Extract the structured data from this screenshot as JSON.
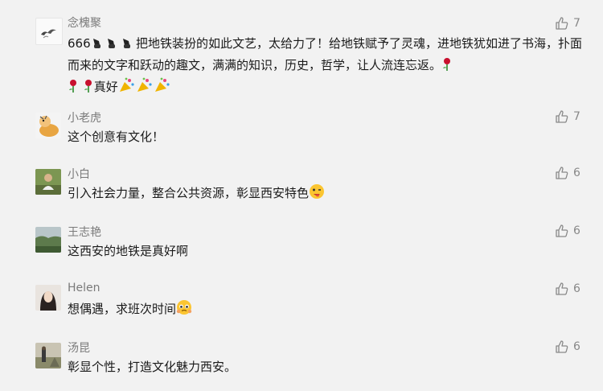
{
  "comments": [
    {
      "name": "念槐聚",
      "text_part1": "666",
      "text_part2": " 把地铁装扮的如此文艺，太给力了！给地铁赋予了灵魂，进地铁犹如进了书海，扑面而来的文字和跃动的趣文，满满的知识，历史，哲学，让人流连忘返。",
      "text_part3": "真好",
      "likes": "7",
      "avatar_icon": "swallows-avatar-icon"
    },
    {
      "name": "小老虎",
      "text": "这个创意有文化！",
      "likes": "7",
      "avatar_icon": "cartoon-avatar-icon"
    },
    {
      "name": "小白",
      "text": "引入社会力量，整合公共资源，彰显西安特色",
      "likes": "6",
      "avatar_icon": "person-photo-avatar-icon"
    },
    {
      "name": "王志艳",
      "text": "这西安的地铁是真好啊",
      "likes": "6",
      "avatar_icon": "landscape-avatar-icon"
    },
    {
      "name": "Helen",
      "text": "想偶遇，求班次时间",
      "likes": "6",
      "avatar_icon": "portrait-avatar-icon"
    },
    {
      "name": "汤昆",
      "text": "彰显个性，打造文化魅力西安。",
      "likes": "6",
      "avatar_icon": "outdoor-avatar-icon"
    }
  ]
}
